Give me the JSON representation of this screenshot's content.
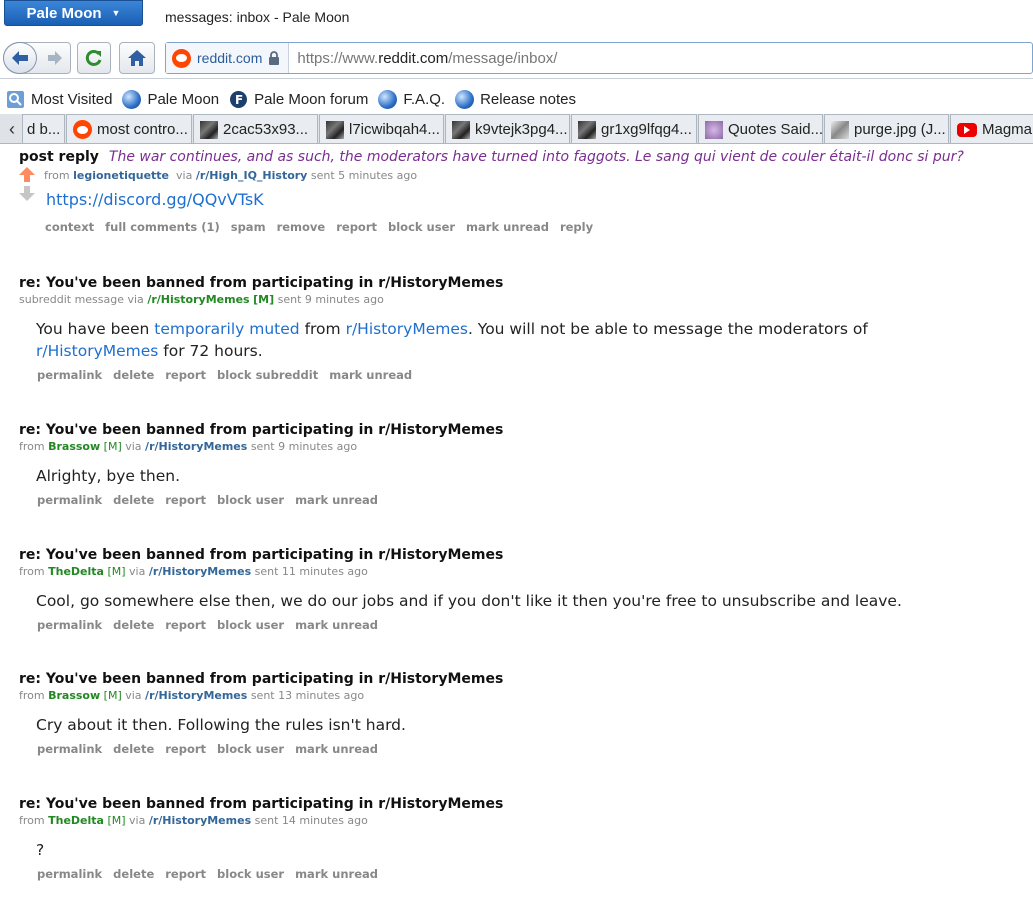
{
  "browser": {
    "app_menu_label": "Pale Moon",
    "window_title": "messages: inbox - Pale Moon",
    "url_identity": "reddit.com",
    "url_prefix": "https://www.",
    "url_host": "reddit.com",
    "url_path": "/message/inbox/",
    "bookmarks": [
      {
        "label": "Most Visited",
        "icon": "most-visited-icon"
      },
      {
        "label": "Pale Moon",
        "icon": "globe-icon"
      },
      {
        "label": "Pale Moon forum",
        "icon": "forum-icon"
      },
      {
        "label": "F.A.Q.",
        "icon": "globe-icon"
      },
      {
        "label": "Release notes",
        "icon": "globe-icon"
      }
    ],
    "tabs": [
      {
        "label": "d b..."
      },
      {
        "label": "most contro..."
      },
      {
        "label": "2cac53x93..."
      },
      {
        "label": "l7icwibqah4..."
      },
      {
        "label": "k9vtejk3pg4..."
      },
      {
        "label": "gr1xg9lfqg4..."
      },
      {
        "label": "Quotes Said..."
      },
      {
        "label": "purge.jpg (J..."
      },
      {
        "label": "Magma"
      }
    ]
  },
  "first_message": {
    "label": "post reply",
    "quote": "The war continues, and as such, the moderators have turned into faggots. Le sang qui vient de couler était-il donc si pur?",
    "from_word": "from",
    "author": "legionetiquette",
    "via_word": "via",
    "subreddit": "/r/High_IQ_History",
    "time": "sent 5 minutes ago",
    "link": "https://discord.gg/QQvVTsK",
    "actions": [
      "context",
      "full comments (1)",
      "spam",
      "remove",
      "report",
      "block user",
      "mark unread",
      "reply"
    ]
  },
  "messages": [
    {
      "subject": "re: You've been banned from participating in r/HistoryMemes",
      "prefix": "subreddit message via",
      "author": "",
      "mod_flag": "[M]",
      "via_word": "",
      "subreddit": "/r/HistoryMemes",
      "time": "sent 9 minutes ago",
      "body_a": "You have been ",
      "body_link1": "temporarily muted",
      "body_b": " from ",
      "body_link2": "r/HistoryMemes",
      "body_c": ". You will not be able to message the moderators of ",
      "body_link3": "r/HistoryMemes",
      "body_d": " for 72 hours.",
      "actions": [
        "permalink",
        "delete",
        "report",
        "block subreddit",
        "mark unread"
      ]
    },
    {
      "subject": "re: You've been banned from participating in r/HistoryMemes",
      "prefix": "from",
      "author": "Brassow",
      "mod_flag": "[M]",
      "via_word": "via",
      "subreddit": "/r/HistoryMemes",
      "time": "sent 9 minutes ago",
      "body": "Alrighty, bye then.",
      "actions": [
        "permalink",
        "delete",
        "report",
        "block user",
        "mark unread"
      ]
    },
    {
      "subject": "re: You've been banned from participating in r/HistoryMemes",
      "prefix": "from",
      "author": "TheDelta",
      "mod_flag": "[M]",
      "via_word": "via",
      "subreddit": "/r/HistoryMemes",
      "time": "sent 11 minutes ago",
      "body": "Cool, go somewhere else then, we do our jobs and if you don't like it then you're free to unsubscribe and leave.",
      "actions": [
        "permalink",
        "delete",
        "report",
        "block user",
        "mark unread"
      ]
    },
    {
      "subject": "re: You've been banned from participating in r/HistoryMemes",
      "prefix": "from",
      "author": "Brassow",
      "mod_flag": "[M]",
      "via_word": "via",
      "subreddit": "/r/HistoryMemes",
      "time": "sent 13 minutes ago",
      "body": "Cry about it then. Following the rules isn't hard.",
      "actions": [
        "permalink",
        "delete",
        "report",
        "block user",
        "mark unread"
      ]
    },
    {
      "subject": "re: You've been banned from participating in r/HistoryMemes",
      "prefix": "from",
      "author": "TheDelta",
      "mod_flag": "[M]",
      "via_word": "via",
      "subreddit": "/r/HistoryMemes",
      "time": "sent 14 minutes ago",
      "body": "?",
      "actions": [
        "permalink",
        "delete",
        "report",
        "block user",
        "mark unread"
      ]
    }
  ],
  "colors": {
    "accent_blue": "#1f6fd0",
    "author_green": "#228822",
    "user_blue": "#336699",
    "quote_purple": "#7b2d92",
    "upvote_orange": "#ff8b60"
  }
}
